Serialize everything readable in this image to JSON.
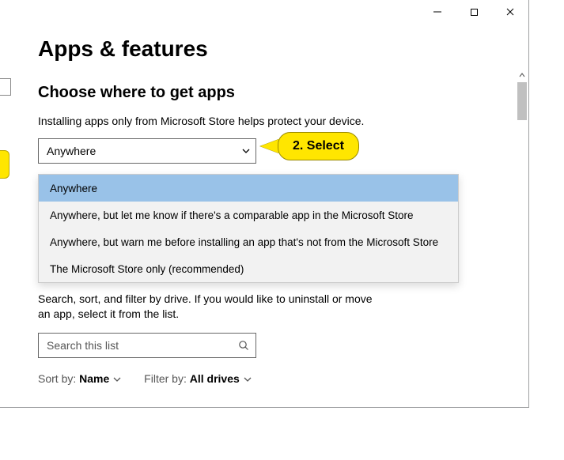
{
  "titlebar": {
    "min": "—",
    "max": "▢",
    "close": "✕"
  },
  "page": {
    "title": "Apps & features",
    "subheading": "Choose where to get apps",
    "helper": "Installing apps only from Microsoft Store helps protect your device."
  },
  "source_select": {
    "value": "Anywhere",
    "options": [
      "Anywhere",
      "Anywhere, but let me know if there's a comparable app in the Microsoft Store",
      "Anywhere, but warn me before installing an app that's not from the Microsoft Store",
      "The Microsoft Store only (recommended)"
    ],
    "selected_index": 0
  },
  "callout": {
    "text": "2. Select"
  },
  "list": {
    "desc": "Search, sort, and filter by drive. If you would like to uninstall or move an app, select it from the list.",
    "search_placeholder": "Search this list",
    "sort_label": "Sort by:",
    "sort_value": "Name",
    "filter_label": "Filter by:",
    "filter_value": "All drives"
  }
}
